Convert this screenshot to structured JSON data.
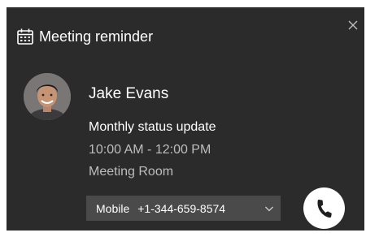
{
  "header": {
    "title": "Meeting reminder",
    "icon": "calendar-icon"
  },
  "contact": {
    "name": "Jake Evans",
    "avatar": "person-avatar"
  },
  "meeting": {
    "subject": "Monthly status update",
    "time": "10:00 AM - 12:00 PM",
    "location": "Meeting Room"
  },
  "phone": {
    "type": "Mobile",
    "number": "+1-344-659-8574"
  },
  "colors": {
    "card_bg": "#2b2b2b",
    "select_bg": "#4a4a4a",
    "secondary_text": "#bdbdbd",
    "call_button": "#ffffff"
  }
}
